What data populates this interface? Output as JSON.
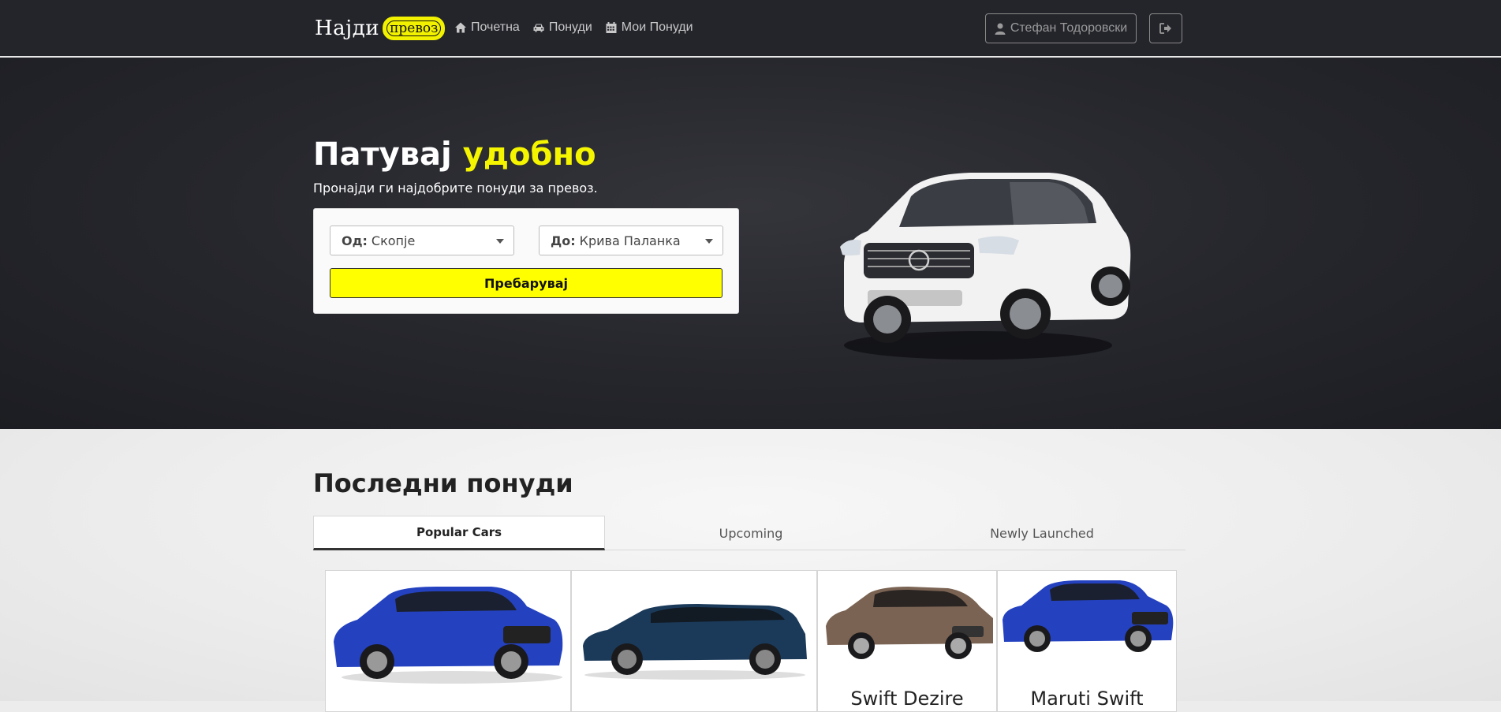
{
  "app": {
    "brand_text": "Најди",
    "brand_badge": "превоз"
  },
  "nav": {
    "items": [
      {
        "label": "Почетна",
        "icon": "home-icon"
      },
      {
        "label": "Понуди",
        "icon": "car-icon"
      },
      {
        "label": "Мои Понуди",
        "icon": "calendar-icon"
      }
    ],
    "user_name": "Стефан Тодоровски",
    "user_icon": "user-icon",
    "logout_icon": "sign-out-icon"
  },
  "hero": {
    "title_main": "Патувај",
    "title_accent": "удобно",
    "subtitle": "Пронајди ги најдобрите понуди за превоз.",
    "from_label": "Од:",
    "from_value": "Скопје",
    "to_label": "До:",
    "to_value": "Крива Паланка",
    "search_button": "Пребарувај"
  },
  "latest": {
    "title": "Последни понуди",
    "tabs": [
      {
        "label": "Popular Cars",
        "active": true
      },
      {
        "label": "Upcoming",
        "active": false
      },
      {
        "label": "Newly Launched",
        "active": false
      }
    ],
    "cards": [
      {
        "name": "",
        "color": "#1f3fb3"
      },
      {
        "name": "",
        "color": "#1b3550"
      },
      {
        "name": "Swift Dezire",
        "color": "#7a6353"
      },
      {
        "name": "Maruti Swift",
        "color": "#1f3fb3"
      }
    ]
  },
  "colors": {
    "accent": "#f5f500",
    "nav_bg": "#24252b",
    "hero_bg": "#26272d"
  }
}
